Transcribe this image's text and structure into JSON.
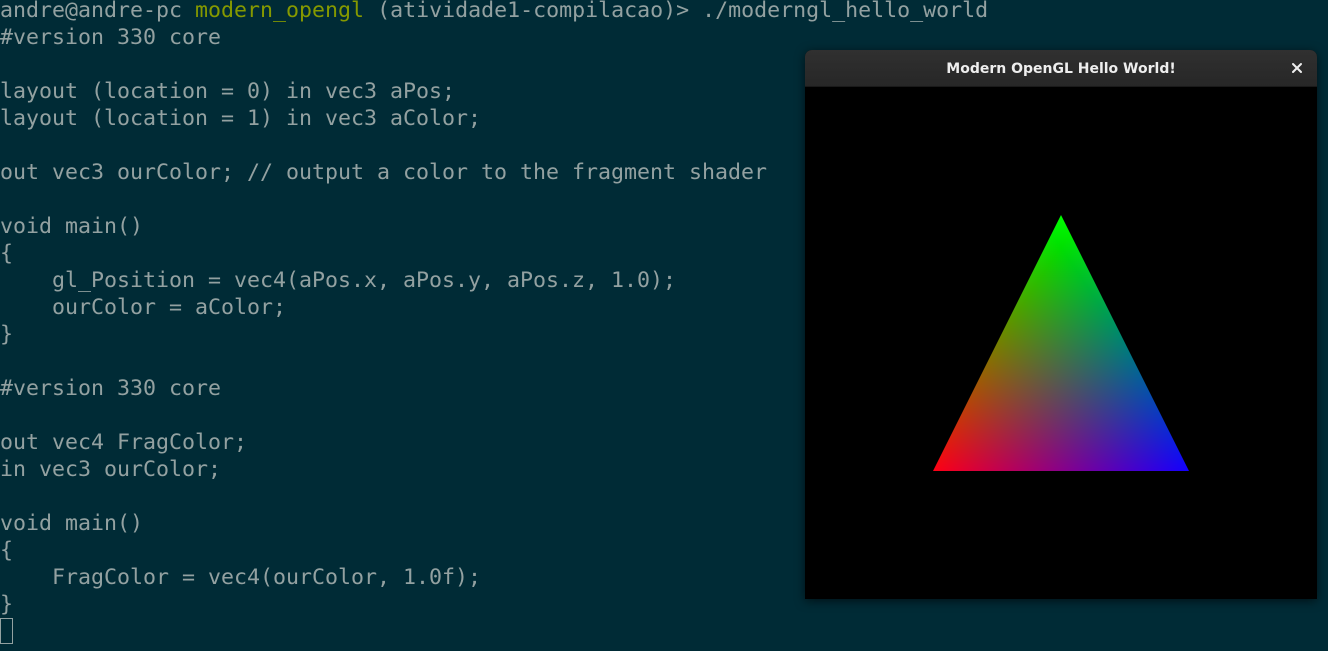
{
  "terminal": {
    "prompt": {
      "user_host": "andre@andre-pc",
      "directory": "modern_opengl",
      "branch": "(atividade1-compilacao)>",
      "command": "./moderngl_hello_world"
    },
    "output_lines": [
      "#version 330 core",
      "",
      "layout (location = 0) in vec3 aPos;",
      "layout (location = 1) in vec3 aColor;",
      "",
      "out vec3 ourColor; // output a color to the fragment shader",
      "",
      "void main()",
      "{",
      "    gl_Position = vec4(aPos.x, aPos.y, aPos.z, 1.0);",
      "    ourColor = aColor;",
      "}",
      "",
      "#version 330 core",
      "",
      "out vec4 FragColor;",
      "in vec3 ourColor;",
      "",
      "void main()",
      "{",
      "    FragColor = vec4(ourColor, 1.0f);",
      "}"
    ],
    "colors": {
      "background": "#002b36",
      "text": "#93a1a1",
      "directory": "#859900"
    }
  },
  "gl_window": {
    "title": "Modern OpenGL Hello World!",
    "close_icon": "close-icon",
    "triangle": {
      "vertex_colors": [
        "#ff0000",
        "#00ff00",
        "#0000ff"
      ]
    }
  }
}
